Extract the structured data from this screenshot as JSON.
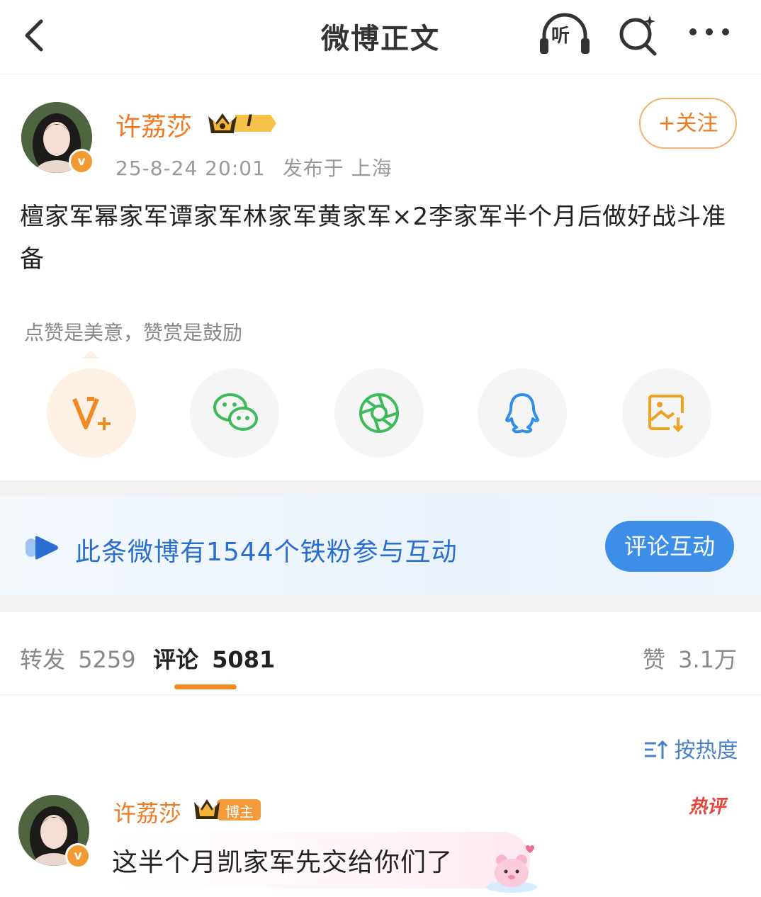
{
  "nav": {
    "title": "微博正文",
    "listen_label": "听",
    "back_icon": "back-chevron-icon",
    "search_icon": "ai-search-icon",
    "more_icon": "more-dots-icon"
  },
  "post": {
    "author": "许荔莎",
    "level_badge": "I",
    "timestamp": "25-8-24 20:01",
    "location": "发布于 上海",
    "follow_label": "+关注",
    "text": "檀家军幂家军谭家军林家军黄家军×2李家军半个月后做好战斗准备"
  },
  "reward": {
    "tip": "点赞是美意，赞赏是鼓励"
  },
  "share": {
    "items": [
      {
        "icon": "reward-v-plus-icon",
        "color": "#f08a25"
      },
      {
        "icon": "wechat-icon",
        "color": "#3dbb5b"
      },
      {
        "icon": "moments-icon",
        "color": "#3dbb5b"
      },
      {
        "icon": "qq-icon",
        "color": "#2f8fe8"
      },
      {
        "icon": "save-image-icon",
        "color": "#f0a321"
      }
    ]
  },
  "fans_banner": {
    "text": "此条微博有1544个铁粉参与互动",
    "button_label": "评论互动"
  },
  "tabs": {
    "repost_label": "转发",
    "repost_count": "5259",
    "comment_label": "评论",
    "comment_count": "5081",
    "like_label": "赞",
    "like_count": "3.1万"
  },
  "sort": {
    "label": "按热度"
  },
  "comment": {
    "author": "许荔莎",
    "badge": "博主",
    "text": "这半个月凯家军先交给你们了",
    "hot_label": "热评"
  },
  "colors": {
    "accent_orange": "#f07a23",
    "link_blue": "#2b6ed2",
    "button_blue": "#3d8ee6"
  }
}
